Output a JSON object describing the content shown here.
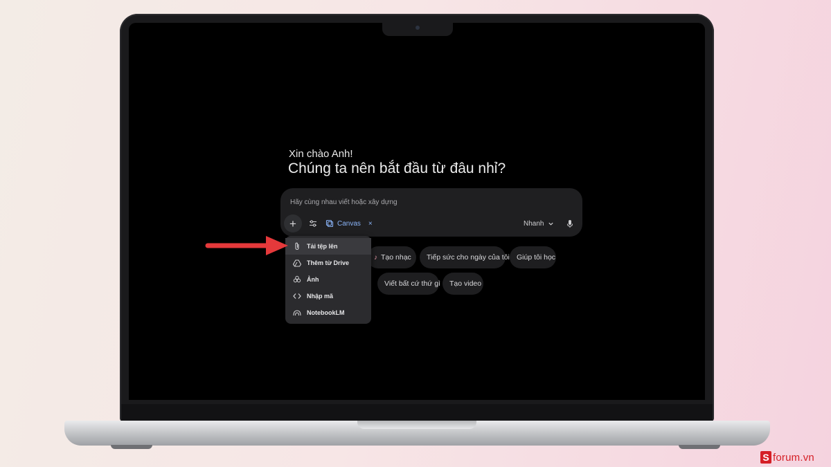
{
  "screen": {
    "greeting_small": "Xin chào Anh!",
    "greeting_big": "Chúng ta nên bắt đầu từ đâu nhỉ?"
  },
  "prompt": {
    "placeholder": "Hãy cùng nhau viết hoặc xây dựng",
    "plus_label": "+",
    "canvas_label": "Canvas",
    "canvas_close": "×",
    "mode_label": "Nhanh"
  },
  "suggestions": [
    {
      "label": "Tạo nhạc",
      "icon": "guitar-icon"
    },
    {
      "label": "Tiếp sức cho ngày của tôi"
    },
    {
      "label": "Giúp tôi học"
    },
    {
      "label": "Viết bất cứ thứ gì"
    },
    {
      "label": "Tạo video"
    }
  ],
  "menu": {
    "items": [
      {
        "label": "Tải tệp lên",
        "icon": "paperclip-icon",
        "active": true
      },
      {
        "label": "Thêm từ Drive",
        "icon": "drive-icon"
      },
      {
        "label": "Ảnh",
        "icon": "photo-icon"
      },
      {
        "label": "Nhập mã",
        "icon": "code-icon"
      },
      {
        "label": "NotebookLM",
        "icon": "notebooklm-icon"
      }
    ]
  },
  "colors": {
    "accent_blue": "#8ab4f8",
    "annotation_arrow": "#e5393b",
    "watermark_red": "#d51f26"
  },
  "watermark": {
    "letter": "S",
    "text": "forum.vn"
  }
}
